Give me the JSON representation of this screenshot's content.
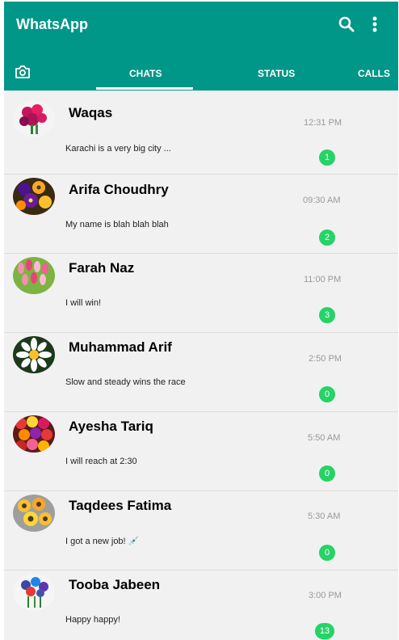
{
  "app": {
    "title": "WhatsApp",
    "header_color": "#009688",
    "badge_color": "#25d366",
    "icons": [
      "search-icon",
      "more-vert-icon",
      "camera-icon"
    ]
  },
  "tabs": [
    {
      "label": "CHATS",
      "active": true
    },
    {
      "label": "STATUS",
      "active": false
    },
    {
      "label": "CALLS",
      "active": false
    }
  ],
  "chats": [
    {
      "name": "Waqas",
      "message": "Karachi is a very big city ...",
      "time": "12:31 PM",
      "unread": "1"
    },
    {
      "name": "Arifa Choudhry",
      "message": "My name is blah blah blah",
      "time": "09:30 AM",
      "unread": "2"
    },
    {
      "name": "Farah Naz",
      "message": "I will win!",
      "time": "11:00 PM",
      "unread": "3"
    },
    {
      "name": "Muhammad Arif",
      "message": "Slow and steady wins the race",
      "time": "2:50 PM",
      "unread": "0"
    },
    {
      "name": "Ayesha Tariq",
      "message": "I will reach at 2:30",
      "time": "5:50 AM",
      "unread": "0"
    },
    {
      "name": "Taqdees Fatima",
      "message": "I got a new job! 💉",
      "time": "5:30 AM",
      "unread": "0"
    },
    {
      "name": "Tooba Jabeen",
      "message": "Happy happy!",
      "time": "3:00 PM",
      "unread": "13"
    }
  ]
}
